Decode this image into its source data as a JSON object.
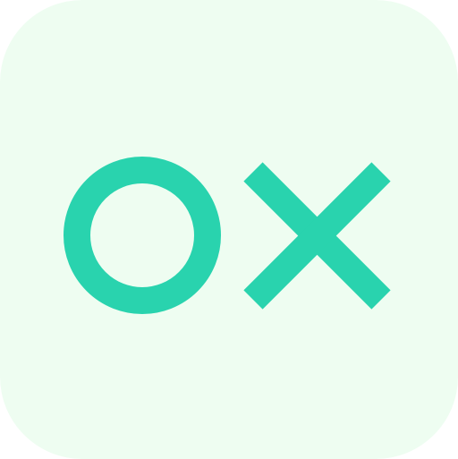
{
  "icon": {
    "name": "ox-app-icon",
    "glyphs": [
      "o-glyph",
      "x-glyph"
    ],
    "colors": {
      "background": "#EEFDF1",
      "accent": "#29D3AE"
    }
  }
}
